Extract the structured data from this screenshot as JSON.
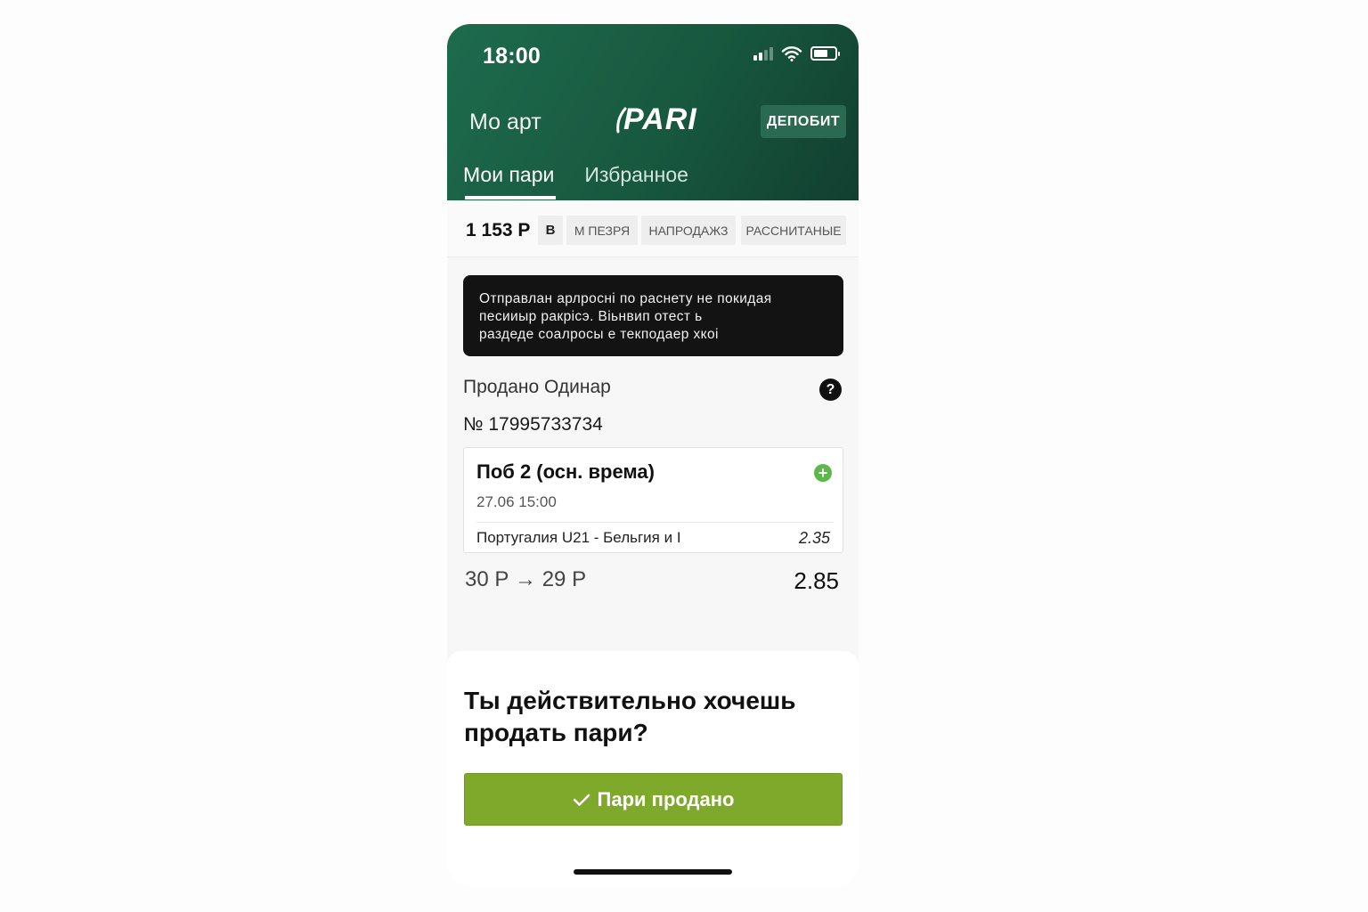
{
  "status_bar": {
    "time": "18:00"
  },
  "header": {
    "title": "Мо арт",
    "logo": "PARI",
    "deposit_label": "ДЕПОБИТ"
  },
  "tabs": [
    {
      "label": "Мои пари",
      "active": true
    },
    {
      "label": "Избранное",
      "active": false
    }
  ],
  "filters": {
    "balance": "1 153 Р",
    "chips": [
      "В",
      "М ПЕЗРЯ",
      "НАПРОДАЖЗ",
      "РАССНИТАНЫЕ"
    ]
  },
  "tooltip": {
    "lines": [
      "Отправлан арлросні по раснету не покидая",
      "песииыр ракрісэ. Віьнвип отест ь",
      "раздеде соалросы е текподаер хкоі"
    ]
  },
  "bet": {
    "type": "Продано Одинар",
    "number": "№ 17995733734",
    "outcome": "Поб 2 (осн. врема)",
    "date": "27.06 15:00",
    "match": "Португалия U21 - Бельгия и I",
    "odds": "2.35",
    "amount": "30 Р → 29 Р",
    "total_odds": "2.85"
  },
  "sheet": {
    "question": "Ты действительно хочешь продать пари?",
    "button_label": "Пари продано"
  },
  "icons": [
    "signal-icon",
    "wifi-icon",
    "battery-icon",
    "help-icon",
    "plus-icon",
    "check-icon"
  ],
  "colors": {
    "header_green": "#1e6b4e",
    "button_green": "#7fa92b",
    "plus_green": "#5cb84a"
  }
}
